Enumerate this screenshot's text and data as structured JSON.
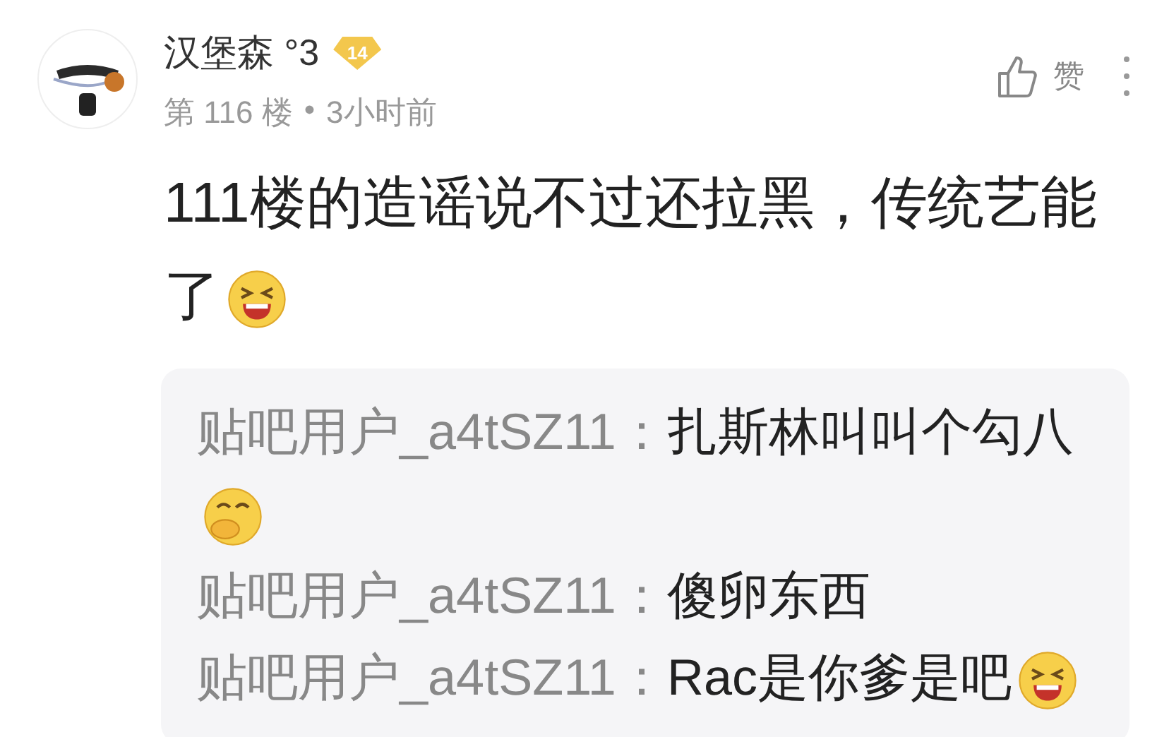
{
  "post": {
    "author": "汉堡森 °3",
    "level_badge": "14",
    "floor": "第 116 楼",
    "dot": "•",
    "time": "3小时前",
    "like_label": "赞",
    "text": "111楼的造谣说不过还拉黑，传统艺能了",
    "kind": "grin"
  },
  "replies": [
    {
      "user": "贴吧用户_a4tSZ11：",
      "text": "扎斯林叫叫个勾八",
      "kind": "giggle"
    },
    {
      "user": "贴吧用户_a4tSZ11：",
      "text": "傻卵东西",
      "kind": "plain"
    },
    {
      "user": "贴吧用户_a4tSZ11：",
      "text": "Rac是你爹是吧",
      "kind": "grin"
    }
  ]
}
